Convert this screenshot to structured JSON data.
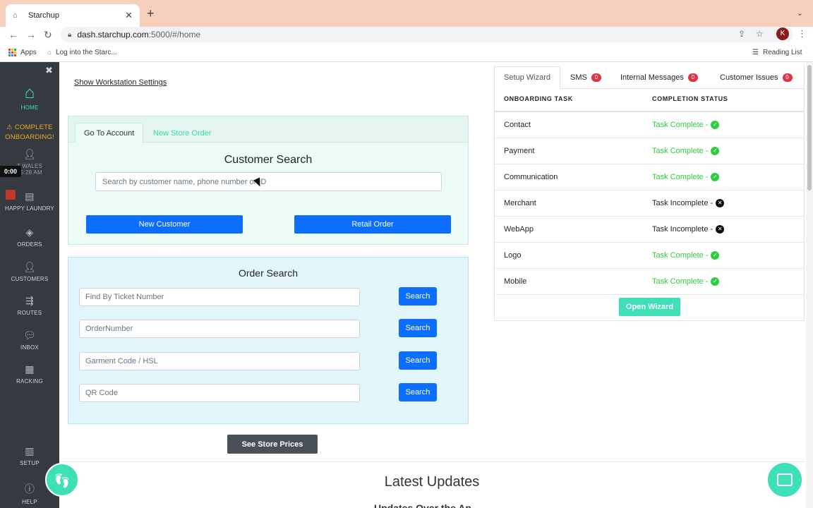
{
  "browser": {
    "tab_title": "Starchup",
    "tab_close": "✕",
    "new_tab": "+",
    "url_host": "dash.starchup.com",
    "url_path": ":5000/#/home",
    "avatar_letter": "K",
    "bookmarks": [
      {
        "label": "Apps"
      },
      {
        "label": "Log into the Starc..."
      }
    ],
    "reading_list": "Reading List"
  },
  "sidebar": {
    "home": "HOME",
    "onboarding_line1": "⚠ COMPLETE",
    "onboarding_line2": "ONBOARDING!",
    "user_name": "T WALES",
    "user_time": "05:28 AM",
    "timer": "0:00",
    "store": "HAPPY LAUNDRY",
    "orders": "ORDERS",
    "customers": "CUSTOMERS",
    "routes": "ROUTES",
    "inbox": "INBOX",
    "racking": "RACKING",
    "setup": "SETUP",
    "help": "HELP"
  },
  "main": {
    "workstation_link": "Show Workstation Settings",
    "tabs": [
      {
        "label": "Go To Account"
      },
      {
        "label": "New Store Order"
      }
    ],
    "customer_search": {
      "title": "Customer Search",
      "placeholder": "Search by customer name, phone number or ID",
      "new_customer": "New Customer",
      "retail_order": "Retail Order"
    },
    "order_search": {
      "title": "Order Search",
      "fields": [
        {
          "placeholder": "Find By Ticket Number",
          "button": "Search"
        },
        {
          "placeholder": "OrderNumber",
          "button": "Search"
        },
        {
          "placeholder": "Garment Code / HSL",
          "button": "Search"
        },
        {
          "placeholder": "QR Code",
          "button": "Search"
        }
      ]
    },
    "store_prices": "See Store Prices",
    "latest_updates": "Latest Updates",
    "updates_sub": "Updates Over the Ap"
  },
  "right_panel": {
    "tabs": [
      {
        "label": "Setup Wizard"
      },
      {
        "label": "SMS",
        "badge": "0"
      },
      {
        "label": "Internal Messages",
        "badge": "0"
      },
      {
        "label": "Customer Issues",
        "badge": "0"
      }
    ],
    "columns": [
      "ONBOARDING TASK",
      "COMPLETION STATUS"
    ],
    "rows": [
      {
        "task": "Contact",
        "status": "Task Complete -",
        "complete": true
      },
      {
        "task": "Payment",
        "status": "Task Complete -",
        "complete": true
      },
      {
        "task": "Communication",
        "status": "Task Complete -",
        "complete": true
      },
      {
        "task": "Merchant",
        "status": "Task Incomplete -",
        "complete": false
      },
      {
        "task": "WebApp",
        "status": "Task Incomplete -",
        "complete": false
      },
      {
        "task": "Logo",
        "status": "Task Complete -",
        "complete": true
      },
      {
        "task": "Mobile",
        "status": "Task Complete -",
        "complete": true
      }
    ],
    "open_wizard": "Open Wizard"
  },
  "colors": {
    "accent": "#3fe0b8",
    "primary": "#0d6efd",
    "success": "#2ecc40",
    "badge": "#dc3545",
    "sidebar": "#343a40"
  }
}
